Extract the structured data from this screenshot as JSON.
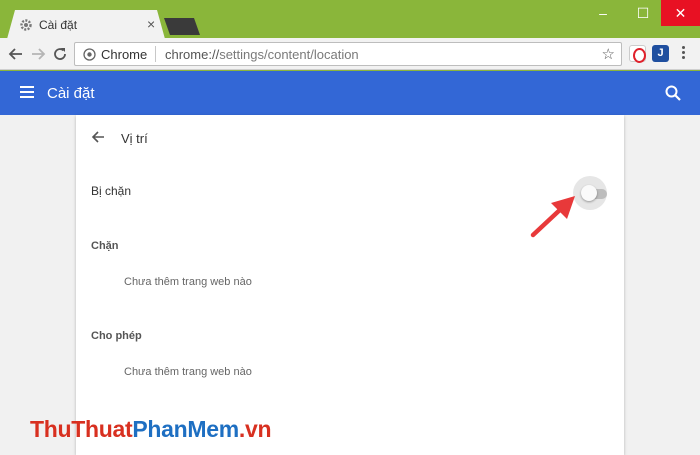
{
  "window": {
    "tab_title": "Cài đặt",
    "tab_close": "×",
    "minimize": "–",
    "maximize": "☐",
    "close": "✕"
  },
  "toolbar": {
    "site_label": "Chrome",
    "url_host": "chrome://",
    "url_path": "settings/content/location",
    "star_icon": "☆",
    "ext_j_label": "J"
  },
  "header": {
    "title": "Cài đặt"
  },
  "location": {
    "title": "Vị trí",
    "toggle_label": "Bị chặn",
    "toggle_on": false,
    "block_section": "Chặn",
    "block_empty": "Chưa thêm trang web nào",
    "allow_section": "Cho phép",
    "allow_empty": "Chưa thêm trang web nào"
  },
  "watermark": {
    "part1": "ThuThuat",
    "part2": "PhanMem",
    "part3": ".vn"
  },
  "colors": {
    "frame": "#8ab63a",
    "header": "#3367d6",
    "annotation_arrow": "#e8393a"
  }
}
